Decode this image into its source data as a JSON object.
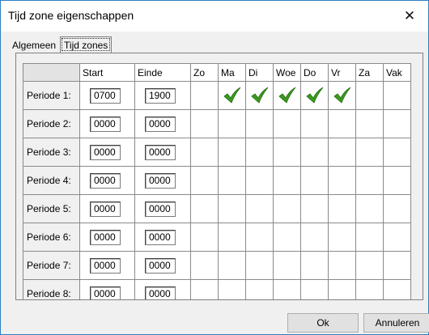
{
  "window": {
    "title": "Tijd zone eigenschappen",
    "close_icon": "close-icon"
  },
  "tabs": [
    {
      "label": "Algemeen",
      "active": false
    },
    {
      "label": "Tijd zones",
      "active": true
    }
  ],
  "grid": {
    "columns": {
      "start": "Start",
      "einde": "Einde",
      "days": [
        "Zo",
        "Ma",
        "Di",
        "Woe",
        "Do",
        "Vr",
        "Za",
        "Vak"
      ]
    },
    "rows": [
      {
        "label": "Periode 1:",
        "start": "0700",
        "end": "1900",
        "days": [
          false,
          true,
          true,
          true,
          true,
          true,
          false,
          false
        ]
      },
      {
        "label": "Periode 2:",
        "start": "0000",
        "end": "0000",
        "days": [
          false,
          false,
          false,
          false,
          false,
          false,
          false,
          false
        ]
      },
      {
        "label": "Periode 3:",
        "start": "0000",
        "end": "0000",
        "days": [
          false,
          false,
          false,
          false,
          false,
          false,
          false,
          false
        ]
      },
      {
        "label": "Periode 4:",
        "start": "0000",
        "end": "0000",
        "days": [
          false,
          false,
          false,
          false,
          false,
          false,
          false,
          false
        ]
      },
      {
        "label": "Periode 5:",
        "start": "0000",
        "end": "0000",
        "days": [
          false,
          false,
          false,
          false,
          false,
          false,
          false,
          false
        ]
      },
      {
        "label": "Periode 6:",
        "start": "0000",
        "end": "0000",
        "days": [
          false,
          false,
          false,
          false,
          false,
          false,
          false,
          false
        ]
      },
      {
        "label": "Periode 7:",
        "start": "0000",
        "end": "0000",
        "days": [
          false,
          false,
          false,
          false,
          false,
          false,
          false,
          false
        ]
      },
      {
        "label": "Periode 8:",
        "start": "0000",
        "end": "0000",
        "days": [
          false,
          false,
          false,
          false,
          false,
          false,
          false,
          false
        ]
      }
    ]
  },
  "buttons": {
    "ok": "Ok",
    "cancel": "Annuleren"
  },
  "colors": {
    "check": "#3c9a1e",
    "window_border": "#2b7fc4"
  }
}
